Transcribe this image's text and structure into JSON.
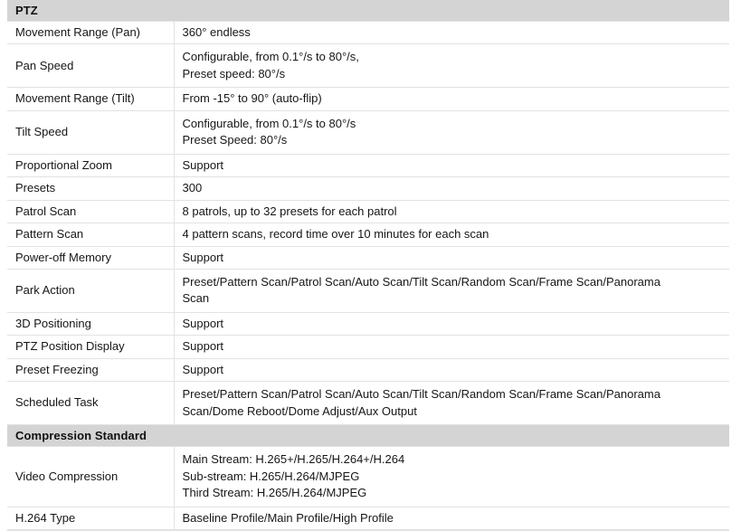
{
  "document": {
    "type": "specification-table",
    "sections": [
      {
        "title": "PTZ",
        "rows": [
          {
            "label": "Movement Range (Pan)",
            "lines": [
              "360° endless"
            ]
          },
          {
            "label": "Pan Speed",
            "lines": [
              "Configurable, from 0.1°/s to 80°/s,",
              "Preset speed: 80°/s"
            ]
          },
          {
            "label": "Movement Range (Tilt)",
            "lines": [
              "From -15° to 90° (auto-flip)"
            ]
          },
          {
            "label": "Tilt Speed",
            "lines": [
              "Configurable, from 0.1°/s to 80°/s",
              "Preset Speed: 80°/s"
            ]
          },
          {
            "label": "Proportional Zoom",
            "lines": [
              "Support"
            ]
          },
          {
            "label": "Presets",
            "lines": [
              "300"
            ]
          },
          {
            "label": "Patrol Scan",
            "lines": [
              "8 patrols, up to 32 presets for each patrol"
            ]
          },
          {
            "label": "Pattern Scan",
            "lines": [
              "4 pattern scans, record time over 10 minutes for each scan"
            ]
          },
          {
            "label": "Power-off Memory",
            "lines": [
              "Support"
            ]
          },
          {
            "label": "Park Action",
            "lines": [
              "Preset/Pattern Scan/Patrol Scan/Auto Scan/Tilt Scan/Random Scan/Frame Scan/Panorama",
              "Scan"
            ]
          },
          {
            "label": "3D Positioning",
            "lines": [
              "Support"
            ]
          },
          {
            "label": "PTZ Position Display",
            "lines": [
              "Support"
            ]
          },
          {
            "label": "Preset Freezing",
            "lines": [
              "Support"
            ]
          },
          {
            "label": "Scheduled Task",
            "lines": [
              "Preset/Pattern Scan/Patrol Scan/Auto Scan/Tilt Scan/Random Scan/Frame Scan/Panorama",
              "Scan/Dome Reboot/Dome Adjust/Aux Output"
            ]
          }
        ]
      },
      {
        "title": "Compression Standard",
        "rows": [
          {
            "label": "Video Compression",
            "lines": [
              "Main Stream: H.265+/H.265/H.264+/H.264",
              "Sub-stream: H.265/H.264/MJPEG",
              "Third Stream: H.265/H.264/MJPEG"
            ]
          },
          {
            "label": "H.264 Type",
            "lines": [
              "Baseline Profile/Main Profile/High Profile"
            ]
          }
        ]
      }
    ]
  },
  "colors": {
    "section_header_bg": "#d4d4d4",
    "border": "#e2e2e2",
    "text": "#161616",
    "page_bg": "#ffffff"
  }
}
